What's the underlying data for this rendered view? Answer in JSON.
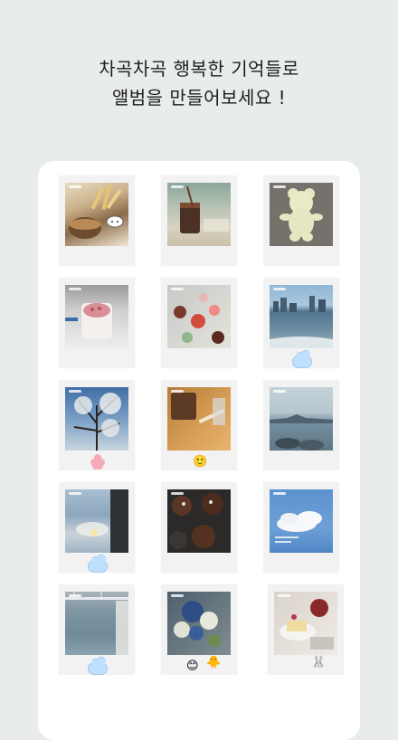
{
  "header": {
    "line1": "차곡차곡 행복한 기억들로",
    "line2": "앨범을 만들어보세요 !"
  },
  "album": {
    "photos": [
      {
        "subject": "fries-and-burger"
      },
      {
        "subject": "iced-coffee"
      },
      {
        "subject": "bear-cookie"
      },
      {
        "subject": "strawberry-drink"
      },
      {
        "subject": "candies"
      },
      {
        "subject": "city-seaside"
      },
      {
        "subject": "cherry-blossom-tree"
      },
      {
        "subject": "coffee-on-table"
      },
      {
        "subject": "sea-bridge"
      },
      {
        "subject": "cloudy-window-sky"
      },
      {
        "subject": "chocolate-muffins"
      },
      {
        "subject": "blue-sky-cloud"
      },
      {
        "subject": "bridge-and-sea"
      },
      {
        "subject": "flower-bouquet"
      },
      {
        "subject": "cake-and-berries"
      }
    ]
  },
  "colors": {
    "background": "#e8ecea",
    "card": "#ffffff",
    "polaroid": "#f2f2f2"
  }
}
